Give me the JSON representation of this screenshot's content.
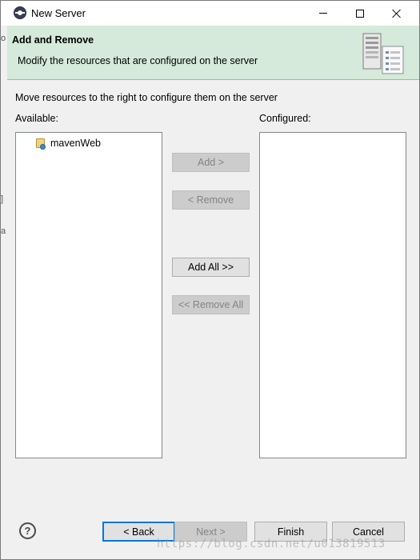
{
  "window": {
    "title": "New Server"
  },
  "banner": {
    "title": "Add and Remove",
    "description": "Modify the resources that are configured on the server",
    "icon": "server-icon"
  },
  "content": {
    "instruction": "Move resources to the right to configure them on the server",
    "available_label": "Available:",
    "configured_label": "Configured:",
    "available_items": [
      {
        "label": "mavenWeb",
        "icon": "web-project-icon"
      }
    ],
    "configured_items": []
  },
  "actions": {
    "add": "Add >",
    "remove": "< Remove",
    "add_all": "Add All >>",
    "remove_all": "<< Remove All"
  },
  "footer": {
    "back": "< Back",
    "next": "Next >",
    "finish": "Finish",
    "cancel": "Cancel"
  },
  "background": {
    "glyphs": [
      "o",
      "]",
      "a"
    ]
  },
  "watermark": "https://blog.csdn.net/u013819513",
  "colors": {
    "banner_bg": "#d5eada",
    "default_button_border": "#0078d7",
    "disabled_text": "#838383"
  }
}
